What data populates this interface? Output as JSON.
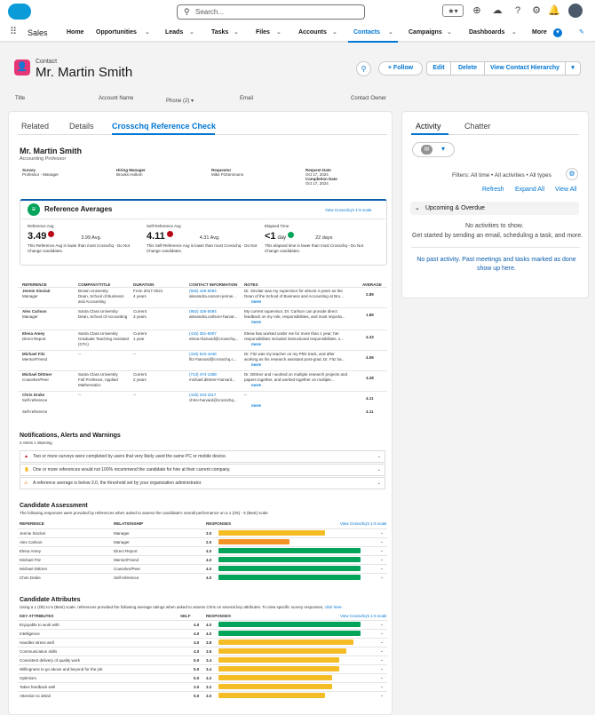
{
  "top": {
    "search_placeholder": "Search..."
  },
  "nav": {
    "app": "Sales",
    "items": [
      "Home",
      "Opportunities",
      "Leads",
      "Tasks",
      "Files",
      "Accounts",
      "Contacts",
      "Campaigns",
      "Dashboards",
      "More"
    ]
  },
  "record": {
    "type": "Contact",
    "name": "Mr. Martin Smith",
    "buttons": {
      "follow": "+ Follow",
      "edit": "Edit",
      "delete": "Delete",
      "hierarchy": "View Contact Hierarchy"
    },
    "fields": {
      "title": "Title",
      "account": "Account Name",
      "phone": "Phone (2) ▾",
      "email": "Email",
      "owner": "Contact Owner"
    }
  },
  "tabs": {
    "related": "Related",
    "details": "Details",
    "crosschq": "Crosschq Reference Check"
  },
  "report": {
    "name": "Mr. Martin Smith",
    "subtitle": "Accounting Professor",
    "meta": [
      {
        "label": "Survey",
        "value": "Professor - Manager"
      },
      {
        "label": "Hiring Manager",
        "value": "Brooks Holtom"
      },
      {
        "label": "Requestor",
        "value": "Mike Fitzsimmons"
      },
      {
        "label": "Request Date",
        "value": "Oct 17, 2024"
      }
    ],
    "completion_label": "Completion Date",
    "completion_value": "Oct 17, 2024",
    "averages_title": "Reference Averages",
    "scale_link": "View Crosschq's 1-5 scale",
    "ref_avg": {
      "label": "Reference Avg",
      "value": "3.49",
      "compare": "3.99 Avg.",
      "note": "This Reference Avg is lower than most Crosschq - Do Not Change candidates."
    },
    "self_avg": {
      "label": "Self-Reference Avg",
      "value": "4.11",
      "compare": "4.31 Avg.",
      "note": "This Self-Reference Avg is lower than most Crosschq - Do Not Change candidates."
    },
    "elapsed": {
      "label": "Elapsed Time",
      "value": "<1",
      "unit": "day",
      "compare": "22 days",
      "note": "This elapsed time is lower than most Crosschq - Do Not Change candidates."
    },
    "table_headers": [
      "REFERENCE",
      "COMPANY/TITLE",
      "DURATION",
      "CONTACT INFORMATION",
      "NOTES",
      "AVERAGE"
    ],
    "refs": [
      {
        "name": "Jennie Sinclair",
        "role": "Manager",
        "company": "Brown University",
        "title": "Dean, School of Business and Accounting",
        "duration": "From 2017-2021",
        "years": "4 years",
        "phone": "(925) 426-5084",
        "email": "alexandra.carson+jennie...",
        "note": "Dr. Sinclair was my supervisor for almost 4 years as the Dean of the School of Business and Accounting at Bro...",
        "avg": "2.89"
      },
      {
        "name": "Alex Carlson",
        "role": "Manager",
        "company": "Santa Clara University",
        "title": "Dean, School of Accounting",
        "duration": "Current",
        "years": "3 years",
        "phone": "(952) 426-5084",
        "email": "alexandra.carlson+harvar...",
        "note": "My current supervisor, Dr. Carlson can provide direct feedback on my role, responsibilities, and most importa...",
        "avg": "1.89"
      },
      {
        "name": "Elena Amey",
        "role": "Direct Report",
        "company": "Santa Clara University",
        "title": "Graduate Teaching Assistant (GTA)",
        "duration": "Current",
        "years": "1 year",
        "phone": "(415) 351-5007",
        "email": "elena+harvard@crosschq...",
        "note": "Elena has worked under me for more than 1 year; her responsibilities included instructional responsibilities, s...",
        "avg": "4.33"
      },
      {
        "name": "Michael Fitz",
        "role": "Mentor/Friend",
        "company": "--",
        "title": "",
        "duration": "--",
        "years": "",
        "phone": "(415) 610-4446",
        "email": "fitz+harvard@crosschq.c...",
        "note": "Dr. Fitz was my teacher on my PhD track, and after working as his research assistant post-grad, Dr. Fitz ha...",
        "avg": "4.06"
      },
      {
        "name": "Michael Dittmer",
        "role": "Coworker/Peer",
        "company": "Santa Clara University",
        "title": "Full Professor, Applied Mathematics",
        "duration": "Current",
        "years": "2 years",
        "phone": "(714) 474-1488",
        "email": "michael.dittmer+harvard...",
        "note": "Dr. Dittmer and I worked on multiple research projects and papers together, and worked together on multiple...",
        "avg": "4.28"
      },
      {
        "name": "Chris Drake",
        "role": "Self-reference",
        "company": "--",
        "title": "",
        "duration": "--",
        "years": "",
        "phone": "(415) 244-3117",
        "email": "chris+harvard@crosschq...",
        "note": "--",
        "avg": "4.11"
      }
    ],
    "self_ref_label": "Self-reference",
    "self_avg_val": "4.11",
    "notif_title": "Notifications, Alerts and Warnings",
    "notif_counts": "2 Alerts  1 Warning",
    "alerts": [
      "Two or more surveys were completed by users that very likely used the same PC or mobile device.",
      "One or more references would not 100% recommend the candidate for hire at their current company.",
      "A reference average is below 3.0, the threshold set by your organization administrator."
    ],
    "assess_title": "Candidate Assessment",
    "assess_sub": "The following responses were provided by references when asked to assess the candidate's overall performance on a 1 (Ok) - 5 (Best) scale",
    "assess_headers": [
      "REFERENCE",
      "RELATIONSHIP",
      "RESPONSES"
    ],
    "assess": [
      {
        "name": "Jennie Sinclair",
        "rel": "Manager",
        "val": "3.0",
        "pct": 0.6,
        "color": "#f4bc25"
      },
      {
        "name": "Alex Carlson",
        "rel": "Manager",
        "val": "2.0",
        "pct": 0.4,
        "color": "#f49325"
      },
      {
        "name": "Elena Amey",
        "rel": "Direct Report",
        "val": "4.0",
        "pct": 0.8,
        "color": "#04a45b"
      },
      {
        "name": "Michael Fitz",
        "rel": "Mentor/Friend",
        "val": "4.0",
        "pct": 0.8,
        "color": "#04a45b"
      },
      {
        "name": "Michael Dittmer",
        "rel": "Coworker/Peer",
        "val": "4.0",
        "pct": 0.8,
        "color": "#04a45b"
      },
      {
        "name": "Chris Drake",
        "rel": "Self-reference",
        "val": "4.0",
        "pct": 0.8,
        "color": "#04a45b"
      }
    ],
    "attr_title": "Candidate Attributes",
    "attr_sub": "Using a 1 (Ok) to 5 (Best) scale, references provided the following average ratings when asked to assess Chris on several key attributes. To view specific survey responses,",
    "attr_sub_link": "click here.",
    "attr_headers": [
      "KEY ATTRIBUTES",
      "SELF",
      "RESPONSES"
    ],
    "attrs": [
      {
        "name": "Enjoyable to work with",
        "self": "4.0",
        "val": "4.0",
        "pct": 0.8,
        "color": "#04a45b"
      },
      {
        "name": "Intelligence",
        "self": "4.0",
        "val": "4.0",
        "pct": 0.8,
        "color": "#04a45b"
      },
      {
        "name": "Handles stress well",
        "self": "3.0",
        "val": "3.8",
        "pct": 0.76,
        "color": "#f4bc25"
      },
      {
        "name": "Communication skills",
        "self": "4.0",
        "val": "3.6",
        "pct": 0.72,
        "color": "#f4bc25"
      },
      {
        "name": "Consistent delivery of quality work",
        "self": "5.0",
        "val": "3.4",
        "pct": 0.68,
        "color": "#f4bc25"
      },
      {
        "name": "Willingness to go above and beyond for the job",
        "self": "5.0",
        "val": "3.4",
        "pct": 0.68,
        "color": "#f4bc25"
      },
      {
        "name": "Optimism",
        "self": "5.0",
        "val": "3.2",
        "pct": 0.64,
        "color": "#f4bc25"
      },
      {
        "name": "Takes feedback well",
        "self": "3.0",
        "val": "3.2",
        "pct": 0.64,
        "color": "#f4bc25"
      },
      {
        "name": "Attention to detail",
        "self": "5.0",
        "val": "3.0",
        "pct": 0.6,
        "color": "#f4bc25"
      }
    ]
  },
  "activity": {
    "tab1": "Activity",
    "tab2": "Chatter",
    "filters": "Filters: All time • All activities • All types",
    "refresh": "Refresh",
    "expand": "Expand All",
    "view": "View All",
    "upcoming": "Upcoming & Overdue",
    "none": "No activities to show.",
    "hint": "Get started by sending an email, scheduling a task, and more.",
    "past": "No past activity. Past meetings and tasks marked as done show up here."
  }
}
